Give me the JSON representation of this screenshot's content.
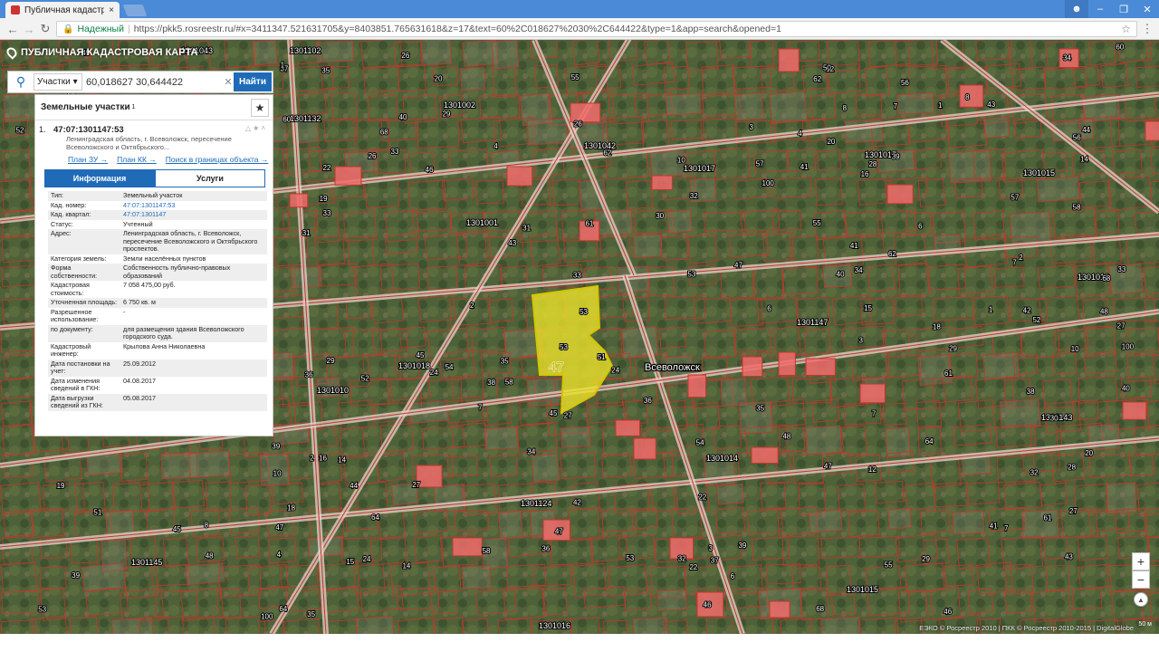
{
  "browser": {
    "tab_title": "Публичная кадастрова",
    "tab_close": "×",
    "secure_label": "Надежный",
    "url": "https://pkk5.rosreestr.ru/#x=3411347.521631705&y=8403851.765631618&z=17&text=60%2C018627%2030%2C644422&type=1&app=search&opened=1",
    "window_controls": [
      "user-icon",
      "minimize-icon",
      "maximize-icon",
      "close-icon"
    ]
  },
  "app": {
    "title": "ПУБЛИЧНАЯ КАДАСТРОВАЯ КАРТА"
  },
  "search": {
    "category": "Участки",
    "query": "60,018627 30,644422",
    "button": "Найти"
  },
  "results": {
    "header": "Земельные участки",
    "count": "1",
    "item_number": "1.",
    "cad_number": "47:07:1301147:53",
    "address_short": "Ленинградская область, г. Всеволожск, пересечение Всеволожского и Октябрьского...",
    "links": [
      "План ЗУ →",
      "План КК →",
      "Поиск в границах объекта →"
    ],
    "tabs": {
      "info": "Информация",
      "services": "Услуги"
    },
    "info_rows": [
      {
        "k": "Тип:",
        "v": "Земельный участок"
      },
      {
        "k": "Кад. номер:",
        "v": "47:07:1301147:53",
        "link": true
      },
      {
        "k": "Кад. квартал:",
        "v": "47:07:1301147",
        "link": true
      },
      {
        "k": "Статус:",
        "v": "Учтенный"
      },
      {
        "k": "Адрес:",
        "v": "Ленинградская область, г. Всеволожск, пересечение Всеволожского и Октябрьского проспектов."
      },
      {
        "k": "Категория земель:",
        "v": "Земли населённых пунктов"
      },
      {
        "k": "Форма собственности:",
        "v": "Собственность публично-правовых образований"
      },
      {
        "k": "Кадастровая стоимость:",
        "v": "7 058 475,00 руб."
      },
      {
        "k": "Уточненная площадь:",
        "v": "6 750 кв. м"
      },
      {
        "k": "Разрешенное использование:",
        "v": "-"
      },
      {
        "k": "по документу:",
        "v": "для размещения здания Всеволожского городского суда."
      },
      {
        "k": "Кадастровый инженер:",
        "v": "Крылова Анна Николаевна"
      },
      {
        "k": "Дата постановки на учет:",
        "v": "25.09.2012"
      },
      {
        "k": "Дата изменения сведений в ГКН:",
        "v": "04.08.2017"
      },
      {
        "k": "Дата выгрузки сведений из ГКН:",
        "v": "05.08.2017"
      }
    ]
  },
  "map": {
    "highlighted_parcel_label": "47",
    "highlighted_parcel_sub": "53",
    "city_label": "Всеволожск",
    "block_labels": [
      "1301102",
      "1301132",
      "1301002",
      "1301001",
      "1301043",
      "1301042",
      "1301017",
      "1301017",
      "1301015",
      "1301016",
      "1301147",
      "1301018",
      "1301010",
      "1301014",
      "1301143",
      "1301124",
      "1301145",
      "1301016",
      "1301015"
    ],
    "plot_numbers": [
      "47",
      "53",
      "35",
      "39",
      "7",
      "7",
      "29",
      "33",
      "27",
      "55",
      "57",
      "15",
      "19",
      "43",
      "37",
      "1",
      "3",
      "2",
      "4",
      "6",
      "8",
      "10",
      "12",
      "14",
      "16",
      "18",
      "20",
      "22",
      "24",
      "26",
      "28",
      "30",
      "31",
      "32",
      "34",
      "36",
      "38",
      "40",
      "41",
      "42",
      "44",
      "45",
      "46",
      "48",
      "49",
      "50",
      "51",
      "52",
      "54",
      "56",
      "58",
      "60",
      "61",
      "62",
      "64",
      "68",
      "100"
    ],
    "attribution": "ЕЭКО © Росреестр 2010 | ПКК © Росреестр 2010-2015 | DigitalGlobe",
    "scale": "50 м",
    "zoom_in": "+",
    "zoom_out": "−",
    "colors": {
      "imagery": "#4b5a3a",
      "parcel_line": "#c0392b",
      "road": "#e8d6cf",
      "highlight": "#e8e22a",
      "building": "#f06b6b"
    }
  }
}
